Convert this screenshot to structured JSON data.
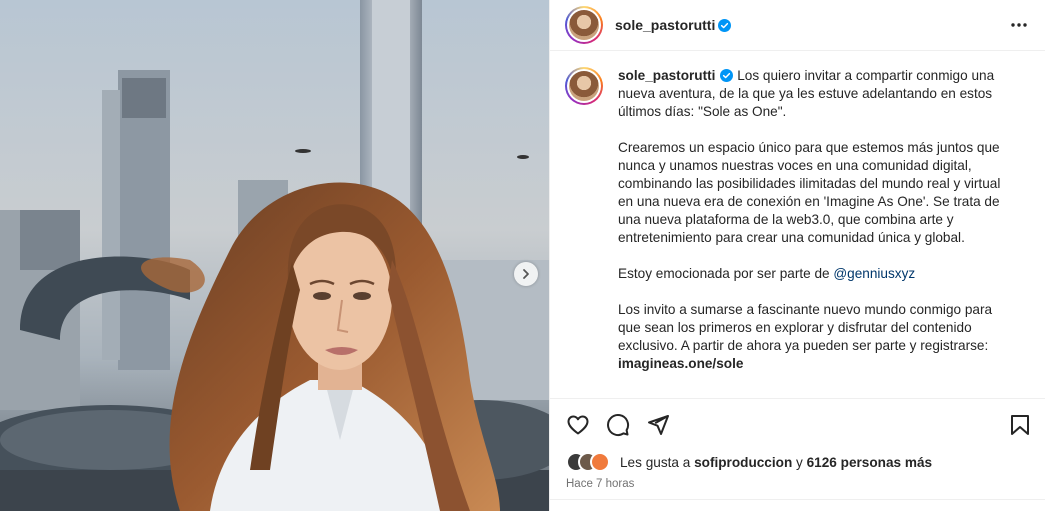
{
  "post": {
    "username": "sole_pastorutti",
    "caption": {
      "intro": "Los quiero invitar a compartir conmigo una nueva aventura, de la que ya les estuve adelantando en estos últimos días: \"Sole as One\".",
      "p2": "Crearemos un espacio único para que estemos más juntos que nunca y unamos nuestras voces en una comunidad digital, combinando las posibilidades ilimitadas del mundo real y virtual en una nueva era de conexión en 'Imagine As One'. Se trata de una nueva plataforma de la web3.0, que combina arte y entretenimiento para crear una comunidad única y global.",
      "p3_prefix": "Estoy emocionada por ser parte de",
      "p3_mention": "@genniusxyz",
      "p4": "Los invito a sumarse a fascinante nuevo mundo conmigo para que sean los primeros en explorar y disfrutar del contenido exclusivo. A partir de ahora ya pueden ser parte y registrarse:",
      "p4_link": "imagineas.one/sole"
    },
    "likes": {
      "prefix": "Les gusta a",
      "first_liker": "sofiproduccion",
      "conj": "y",
      "others": "6126 personas más"
    },
    "timestamp": "Hace 7 horas"
  },
  "icons": {
    "verified": "verified-badge-icon",
    "more": "more-options-icon",
    "next": "chevron-right-icon",
    "like": "heart-icon",
    "comment": "comment-icon",
    "share": "send-icon",
    "save": "bookmark-icon"
  },
  "colors": {
    "verified_blue": "#0095f6",
    "mention_blue": "#00376b",
    "text": "#262626",
    "muted": "#737373",
    "divider": "#efefef"
  }
}
